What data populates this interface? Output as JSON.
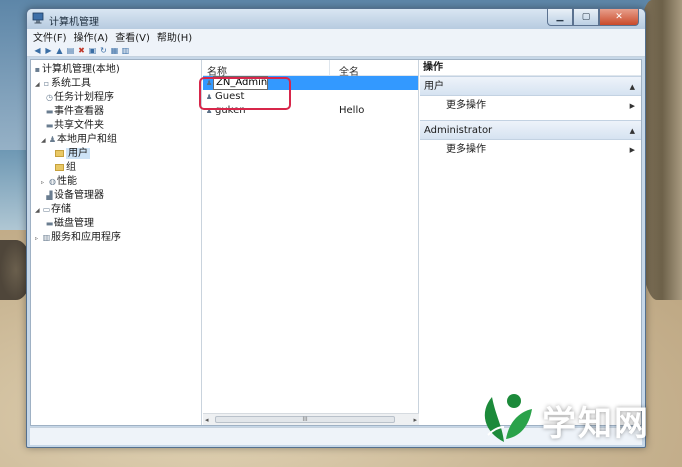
{
  "window": {
    "title": "计算机管理"
  },
  "menu": [
    "文件(F)",
    "操作(A)",
    "查看(V)",
    "帮助(H)"
  ],
  "tree": {
    "root": "计算机管理(本地)",
    "system_tools": "系统工具",
    "task_scheduler": "任务计划程序",
    "event_viewer": "事件查看器",
    "shared_folders": "共享文件夹",
    "local_users_groups": "本地用户和组",
    "users": "用户",
    "groups": "组",
    "performance": "性能",
    "device_manager": "设备管理器",
    "storage": "存储",
    "disk_management": "磁盘管理",
    "services_apps": "服务和应用程序"
  },
  "list": {
    "col_name": "名称",
    "col_fullname": "全名",
    "rows": [
      {
        "name": "ZN_Admin",
        "fullname": ""
      },
      {
        "name": "Guest",
        "fullname": ""
      },
      {
        "name": "guken",
        "fullname": "Hello"
      }
    ],
    "scroll_thumb": "III"
  },
  "actions": {
    "title": "操作",
    "section1": "用户",
    "section1_item": "更多操作",
    "section2": "Administrator",
    "section2_item": "更多操作"
  },
  "watermark": {
    "text": "学知网"
  },
  "colors": {
    "selection": "#3399ff",
    "highlight_ring": "#d7264a",
    "watermark_green": "#1c8a3a"
  }
}
